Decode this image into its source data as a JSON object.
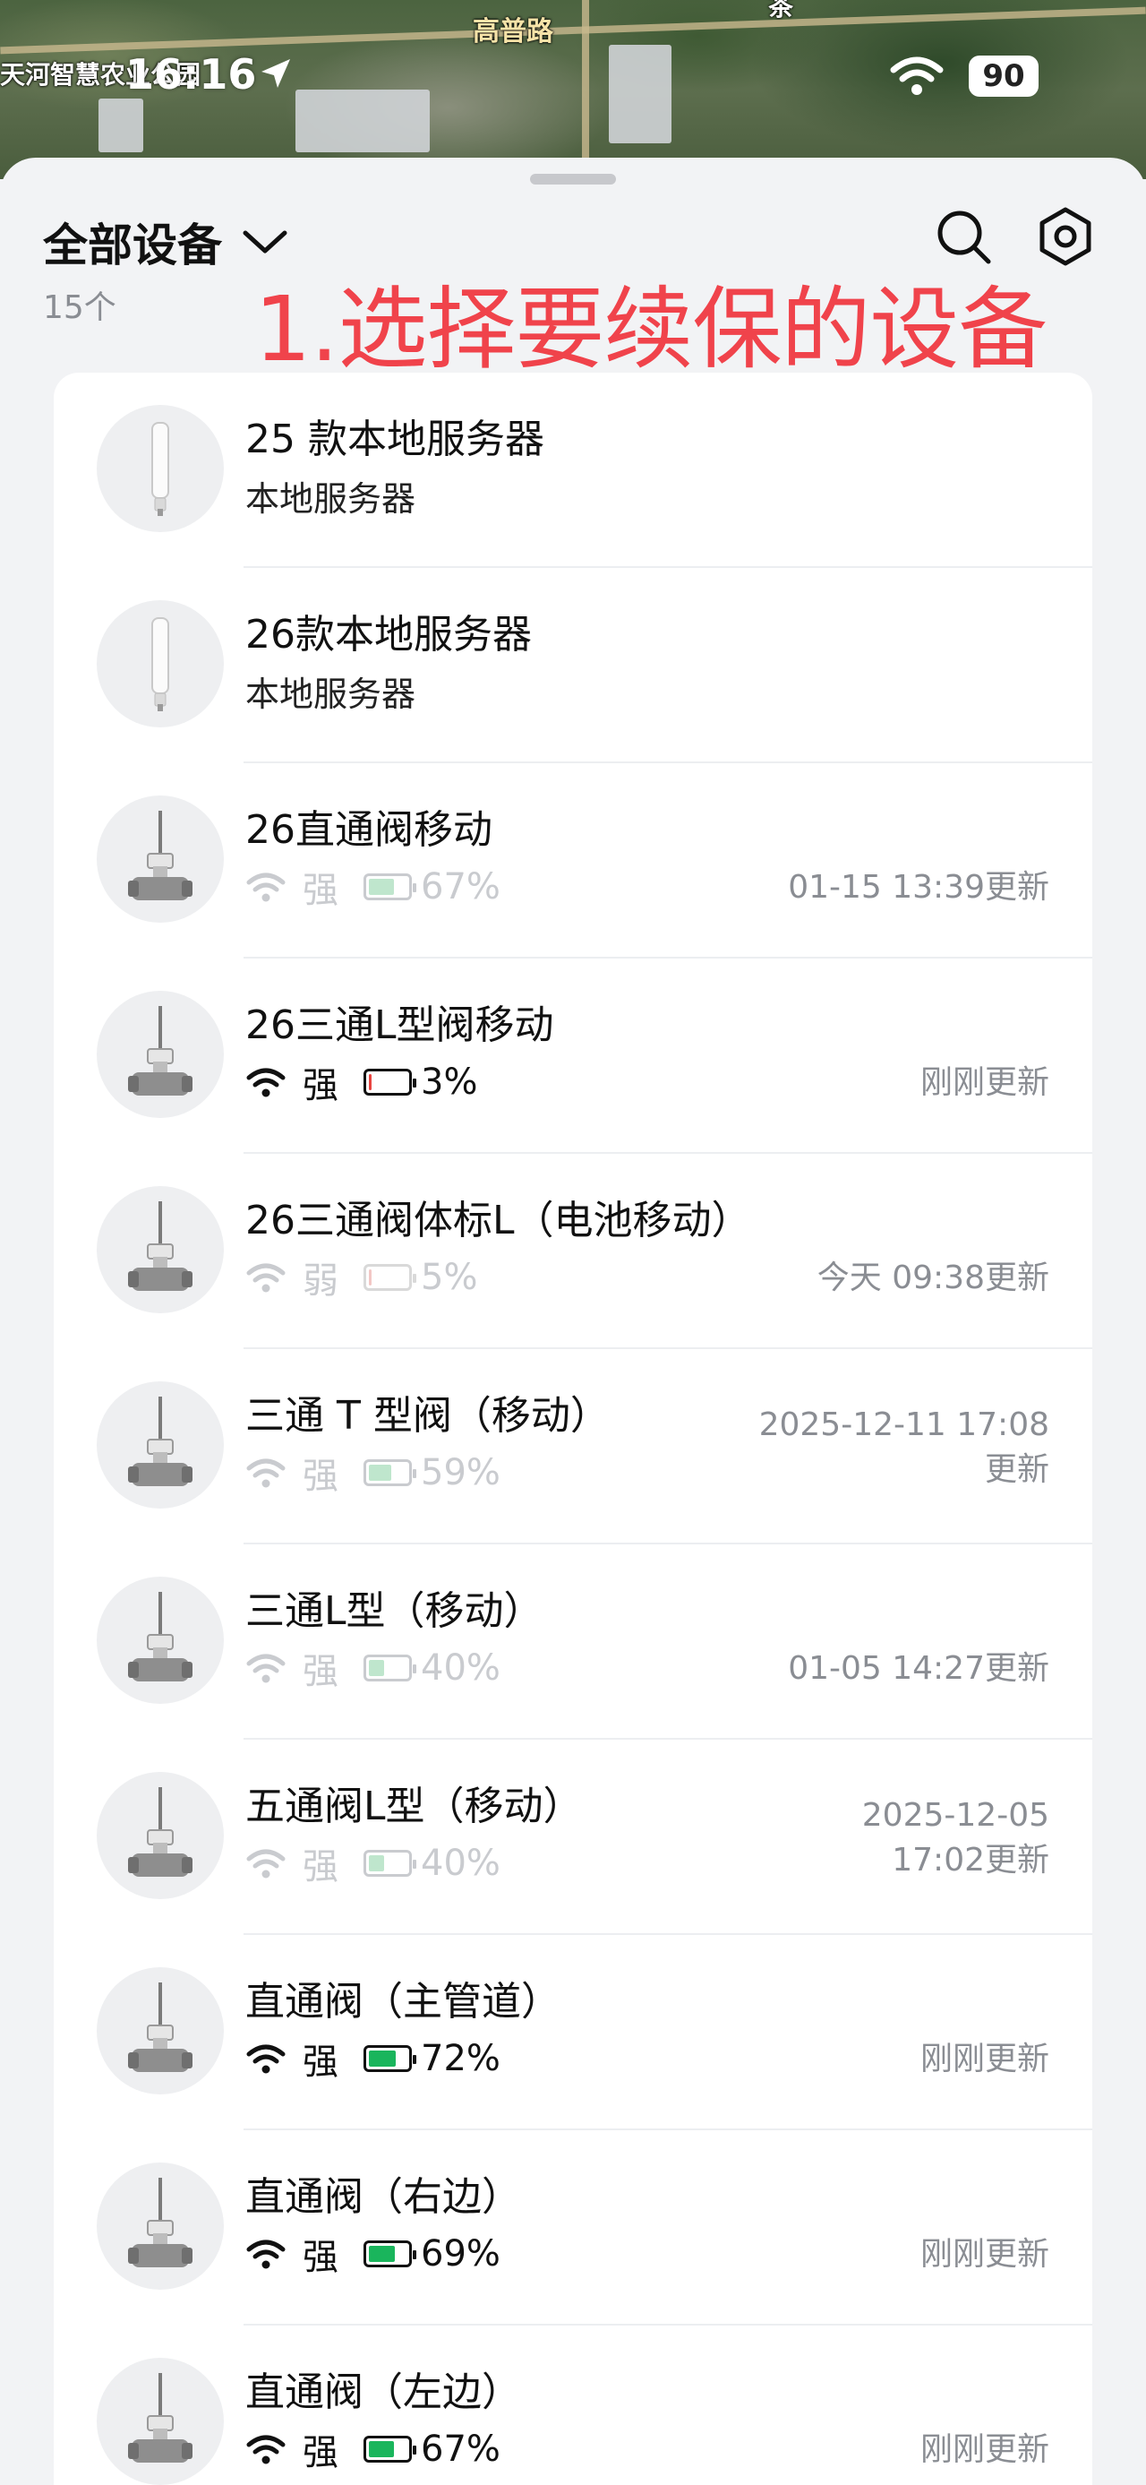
{
  "map": {
    "road_label": "高普路",
    "place_label": "天河智慧农业公园",
    "corner_label": "茶"
  },
  "status_bar": {
    "time": "16:16",
    "battery": "90"
  },
  "header": {
    "title": "全部设备",
    "count": "15个"
  },
  "annotation": "1.选择要续保的设备",
  "devices": [
    {
      "name": "25 款本地服务器",
      "subtitle": "本地服务器",
      "icon": "antenna-server-icon"
    },
    {
      "name": "26款本地服务器",
      "subtitle": "本地服务器",
      "icon": "antenna-server-icon"
    },
    {
      "name": "26直通阀移动",
      "signal": "强",
      "battery": "67%",
      "battery_level": 67,
      "online": false,
      "updated": "01-15 13:39更新",
      "icon": "valve-icon"
    },
    {
      "name": "26三通L型阀移动",
      "signal": "强",
      "battery": "3%",
      "battery_level": 3,
      "online": true,
      "updated": "刚刚更新",
      "icon": "valve-icon"
    },
    {
      "name": "26三通阀体标L（电池移动）",
      "signal": "弱",
      "battery": "5%",
      "battery_level": 5,
      "online": false,
      "updated": "今天 09:38更新",
      "icon": "valve-icon"
    },
    {
      "name": "三通 T 型阀（移动）",
      "signal": "强",
      "battery": "59%",
      "battery_level": 59,
      "online": false,
      "updated_line1": "2025-12-11 17:08",
      "updated_line2": "更新",
      "icon": "valve-icon"
    },
    {
      "name": "三通L型（移动）",
      "signal": "强",
      "battery": "40%",
      "battery_level": 40,
      "online": false,
      "updated": "01-05 14:27更新",
      "icon": "valve-icon"
    },
    {
      "name": "五通阀L型（移动）",
      "signal": "强",
      "battery": "40%",
      "battery_level": 40,
      "online": false,
      "updated_line1": "2025-12-05",
      "updated_line2": "17:02更新",
      "icon": "valve-icon"
    },
    {
      "name": "直通阀（主管道）",
      "signal": "强",
      "battery": "72%",
      "battery_level": 72,
      "online": true,
      "updated": "刚刚更新",
      "icon": "valve-icon"
    },
    {
      "name": "直通阀（右边）",
      "signal": "强",
      "battery": "69%",
      "battery_level": 69,
      "online": true,
      "updated": "刚刚更新",
      "icon": "valve-icon"
    },
    {
      "name": "直通阀（左边）",
      "signal": "强",
      "battery": "67%",
      "battery_level": 67,
      "online": true,
      "updated": "刚刚更新",
      "icon": "valve-icon"
    }
  ],
  "colors": {
    "battery_green": "#1ab55c",
    "battery_red": "#e8433f",
    "battery_dim_fill": "#bfe6cd",
    "annotation_red": "#f0434b"
  }
}
